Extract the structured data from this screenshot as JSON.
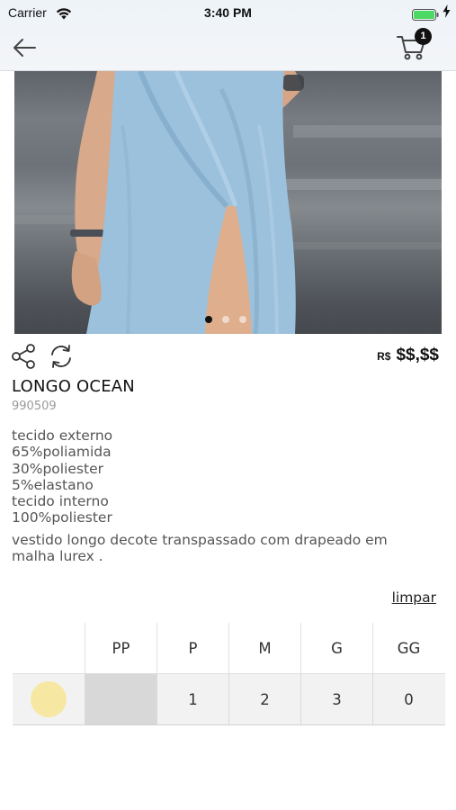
{
  "status_bar": {
    "carrier": "Carrier",
    "time": "3:40 PM"
  },
  "nav": {
    "back_icon": "arrow-left-icon",
    "cart_icon": "shopping-cart-icon",
    "cart_count": "1"
  },
  "gallery": {
    "image": "product-photo-light-blue-wrap-dress",
    "slides": 3,
    "active_slide": 0
  },
  "actions": {
    "share_icon": "share-icon",
    "refresh_icon": "refresh-icon"
  },
  "product": {
    "currency": "R$",
    "price": "$$,$$",
    "name": "LONGO OCEAN",
    "sku": "990509",
    "composition": [
      "tecido externo",
      "65%poliamida",
      "30%poliester",
      "5%elastano",
      "tecido interno",
      "100%poliester"
    ],
    "description": "vestido longo decote transpassado com drapeado em malha lurex ."
  },
  "size_selector": {
    "clear_label": "limpar",
    "sizes": [
      "PP",
      "P",
      "M",
      "G",
      "GG"
    ],
    "rows": [
      {
        "color": "#f6e8a2",
        "quantities": [
          "",
          "1",
          "2",
          "3",
          "0"
        ],
        "disabled": [
          true,
          false,
          false,
          false,
          false
        ]
      }
    ]
  },
  "colors": {
    "accent": "#111111",
    "swatch_yellow": "#f6e8a2",
    "battery_green": "#4cd964"
  }
}
